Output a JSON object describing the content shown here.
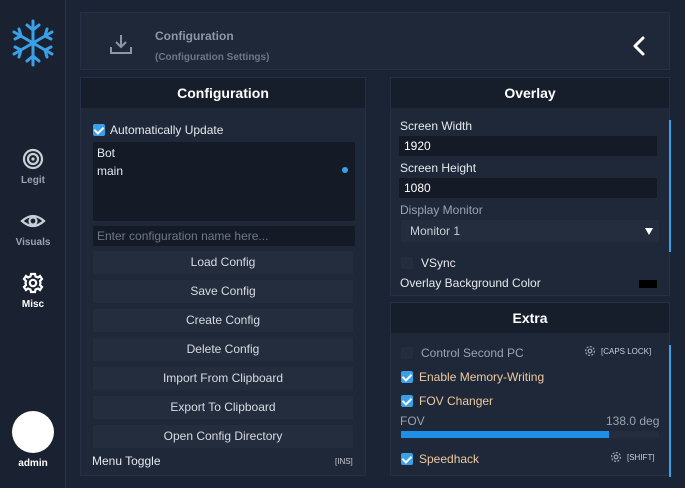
{
  "sidebar": {
    "items": [
      {
        "label": "Legit",
        "icon": "target-icon"
      },
      {
        "label": "Visuals",
        "icon": "eye-icon"
      },
      {
        "label": "Misc",
        "icon": "gear-icon"
      }
    ],
    "user": {
      "name": "admin"
    }
  },
  "header": {
    "title": "Configuration",
    "subtitle": "(Configuration Settings)"
  },
  "configuration": {
    "title": "Configuration",
    "auto_update_label": "Automatically Update",
    "auto_update_checked": true,
    "configs": [
      "Bot",
      "main"
    ],
    "selected_config": "main",
    "name_placeholder": "Enter configuration name here...",
    "buttons": {
      "load": "Load Config",
      "save": "Save Config",
      "create": "Create Config",
      "delete": "Delete Config",
      "import": "Import From Clipboard",
      "export": "Export To Clipboard",
      "open_dir": "Open Config Directory"
    },
    "menu_toggle_label": "Menu Toggle",
    "menu_toggle_key": "[INS]"
  },
  "overlay": {
    "title": "Overlay",
    "screen_width_label": "Screen Width",
    "screen_width": "1920",
    "screen_height_label": "Screen Height",
    "screen_height": "1080",
    "display_monitor_label": "Display Monitor",
    "display_monitor_value": "Monitor 1",
    "vsync_label": "VSync",
    "vsync_checked": false,
    "bg_color_label": "Overlay Background Color",
    "bg_color": "#000000"
  },
  "extra": {
    "title": "Extra",
    "control_second_pc_label": "Control Second PC",
    "control_second_pc_key": "[CAPS LOCK]",
    "memory_writing_label": "Enable Memory-Writing",
    "fov_changer_label": "FOV Changer",
    "fov_label": "FOV",
    "fov_value": "138.0 deg",
    "fov_fraction": 0.805,
    "speedhack_label": "Speedhack",
    "speedhack_key": "[SHIFT]"
  },
  "colors": {
    "accent": "#3aa0e8",
    "background": "#1b2434",
    "panel": "#1e2838",
    "button": "#242d3d"
  }
}
